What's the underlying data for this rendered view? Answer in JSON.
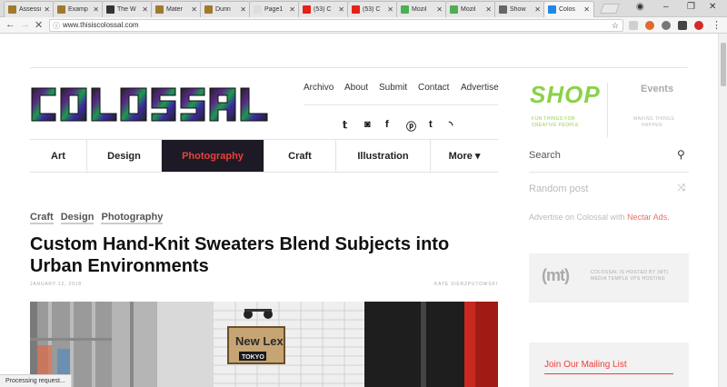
{
  "browser": {
    "tabs": [
      {
        "label": "Assessi",
        "favicon_color": "#a07a2c",
        "active": false
      },
      {
        "label": "Examp",
        "favicon_color": "#a07a2c",
        "active": false
      },
      {
        "label": "The W",
        "favicon_color": "#333333",
        "active": false
      },
      {
        "label": "Mater",
        "favicon_color": "#a07a2c",
        "active": false
      },
      {
        "label": "Durin",
        "favicon_color": "#a07a2c",
        "active": false
      },
      {
        "label": "Page1",
        "favicon_color": "#dddddd",
        "active": false
      },
      {
        "label": "(53) C",
        "favicon_color": "#e62117",
        "active": false
      },
      {
        "label": "(53) C",
        "favicon_color": "#e62117",
        "active": false
      },
      {
        "label": "Mozil",
        "favicon_color": "#4caf50",
        "active": false
      },
      {
        "label": "Mozil",
        "favicon_color": "#4caf50",
        "active": false
      },
      {
        "label": "Show",
        "favicon_color": "#666666",
        "active": false
      },
      {
        "label": "Colos",
        "favicon_color": "#1e88e5",
        "active": true
      }
    ],
    "url": "www.thisiscolossal.com",
    "status": "Processing request..."
  },
  "site": {
    "logo_text": "COLOSSAL",
    "top_links": [
      "Archivo",
      "About",
      "Submit",
      "Contact",
      "Advertise"
    ],
    "social_icons": [
      "twitter-icon",
      "instagram-icon",
      "facebook-icon",
      "pinterest-icon",
      "tumblr-icon",
      "rss-icon"
    ],
    "shop": {
      "title": "SHOP",
      "tagline_1": "FUN THINGS FOR",
      "tagline_2": "CREATIVE PEOPLE"
    },
    "events": {
      "title": "Events",
      "tagline_1": "MAKING THINGS",
      "tagline_2": "HAPPEN"
    },
    "categories": [
      "Art",
      "Design",
      "Photography",
      "Craft",
      "Illustration",
      "More ▾"
    ],
    "active_category": "Photography",
    "accent_color": "#e8413a",
    "shop_color": "#8bd14a"
  },
  "sidebar": {
    "search_label": "Search",
    "random_label": "Random post",
    "advertise_prefix": "Advertise on Colossal with ",
    "advertise_link": "Nectar Ads.",
    "mt_logo": "(mt)",
    "mt_text_1": "COLOSSAL IS HOSTED BY (MT)",
    "mt_text_2": "MEDIA TEMPLE VPS HOSTING",
    "mailing_list": "Join Our Mailing List"
  },
  "article": {
    "tags": [
      "Craft",
      "Design",
      "Photography"
    ],
    "title": "Custom Hand-Knit Sweaters Blend Subjects into Urban Environments",
    "date": "JANUARY 12, 2018",
    "author": "KATE SIERZPUTOWSKI",
    "image_sign_line1": "New Lex",
    "image_sign_line2": "TOKYO"
  }
}
